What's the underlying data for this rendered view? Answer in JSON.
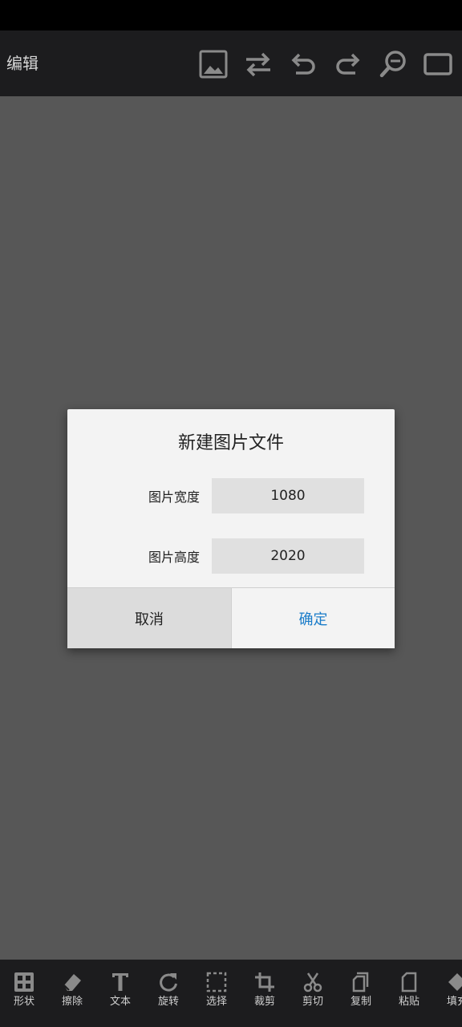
{
  "header": {
    "title": "编辑",
    "icons": [
      "image-icon",
      "swap-icon",
      "undo-icon",
      "redo-icon",
      "zoom-out-icon",
      "rectangle-icon"
    ]
  },
  "dialog": {
    "title": "新建图片文件",
    "width_label": "图片宽度",
    "width_value": "1080",
    "height_label": "图片高度",
    "height_value": "2020",
    "cancel_label": "取消",
    "ok_label": "确定"
  },
  "toolbar": {
    "items": [
      {
        "label": "形状",
        "icon": "shapes-icon"
      },
      {
        "label": "擦除",
        "icon": "eraser-icon"
      },
      {
        "label": "文本",
        "icon": "text-icon"
      },
      {
        "label": "旋转",
        "icon": "rotate-icon"
      },
      {
        "label": "选择",
        "icon": "select-icon"
      },
      {
        "label": "裁剪",
        "icon": "crop-icon"
      },
      {
        "label": "剪切",
        "icon": "scissors-icon"
      },
      {
        "label": "复制",
        "icon": "copy-icon"
      },
      {
        "label": "粘贴",
        "icon": "paste-icon"
      },
      {
        "label": "填充",
        "icon": "fill-icon"
      }
    ]
  },
  "colors": {
    "bar_bg": "#1c1c1e",
    "canvas_bg": "#575757",
    "dialog_bg": "#f3f3f3",
    "accent": "#1a7cc9",
    "icon_gray": "#8a8a8a"
  }
}
